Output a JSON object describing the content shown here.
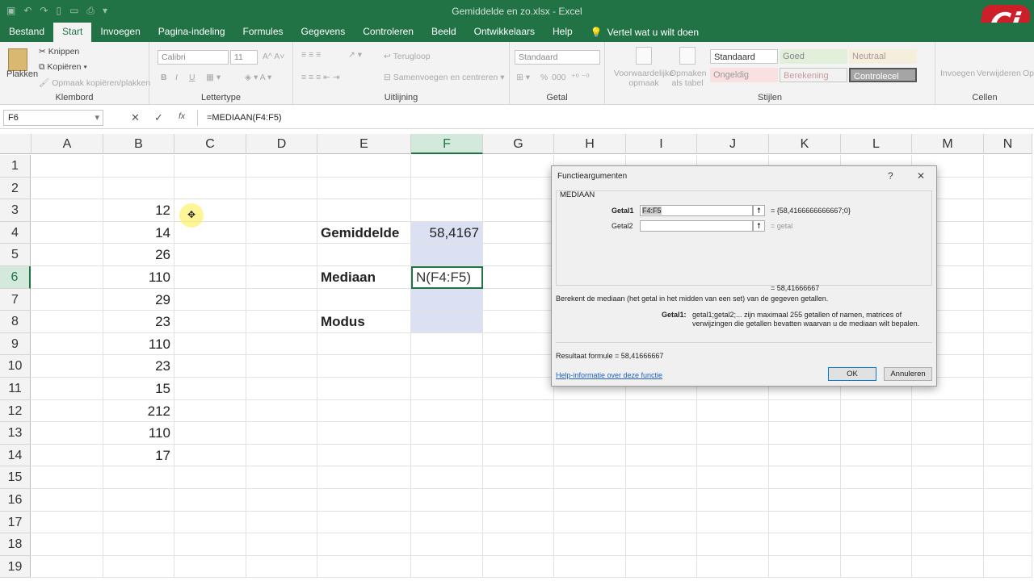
{
  "app": {
    "window_title": "Gemiddelde en zo.xlsx  -  Excel",
    "logo_text": "Ci"
  },
  "tabs": [
    "Bestand",
    "Start",
    "Invoegen",
    "Pagina-indeling",
    "Formules",
    "Gegevens",
    "Controleren",
    "Beeld",
    "Ontwikkelaars",
    "Help"
  ],
  "tell_me": "Vertel wat u wilt doen",
  "ribbon": {
    "clipboard": {
      "paste": "Plakken",
      "cut": "Knippen",
      "copy": "Kopiëren",
      "format_painter": "Opmaak kopiëren/plakken",
      "label": "Klembord"
    },
    "font": {
      "name": "Calibri",
      "size": "11",
      "label": "Lettertype",
      "bold": "B",
      "italic": "I",
      "underline": "U"
    },
    "alignment": {
      "wrap": "Terugloop",
      "merge": "Samenvoegen en centreren",
      "label": "Uitlijning"
    },
    "number": {
      "format": "Standaard",
      "percent": "%",
      "thousands": "000",
      "label": "Getal"
    },
    "styles": {
      "conditional": "Voorwaardelijke opmaak",
      "table": "Opmaken als tabel",
      "standaard": "Standaard",
      "goed": "Goed",
      "neutraal": "Neutraal",
      "ongeldig": "Ongeldig",
      "berekening": "Berekening",
      "controlecel": "Controlecel",
      "label": "Stijlen"
    },
    "cells": {
      "insert": "Invoegen",
      "delete": "Verwijderen",
      "format": "Opm",
      "label": "Cellen"
    }
  },
  "formula_bar": {
    "name_box": "F6",
    "fx": "fx",
    "formula": "=MEDIAAN(F4:F5)"
  },
  "columns": [
    "A",
    "B",
    "C",
    "D",
    "E",
    "F",
    "G",
    "H",
    "I",
    "J",
    "K",
    "L",
    "M",
    "N"
  ],
  "rows": [
    "1",
    "2",
    "3",
    "4",
    "5",
    "6",
    "7",
    "8",
    "9",
    "10",
    "11",
    "12",
    "13",
    "14",
    "15",
    "16",
    "17",
    "18",
    "19"
  ],
  "cells": {
    "B3": "12",
    "B4": "14",
    "B5": "26",
    "B6": "110",
    "B7": "29",
    "B8": "23",
    "B9": "110",
    "B10": "23",
    "B11": "15",
    "B12": "212",
    "B13": "110",
    "B14": "17",
    "E4": "Gemiddelde",
    "F4": "58,4167",
    "E6": "Mediaan",
    "F6": "N(F4:F5)",
    "E8": "Modus"
  },
  "dialog": {
    "title": "Functieargumenten",
    "help": "?",
    "close": "✕",
    "function": "MEDIAAN",
    "arg1_label": "Getal1",
    "arg1_value": "F4:F5",
    "arg1_result": "=  {58,4166666666667;0}",
    "arg2_label": "Getal2",
    "arg2_value": "",
    "arg2_result": "=  getal",
    "result_line": "=  58,41666667",
    "description": "Berekent de mediaan (het getal in het midden van een set) van de gegeven getallen.",
    "arg_help_label": "Getal1:",
    "arg_help_line1": "getal1;getal2;... zijn maximaal 255 getallen of namen, matrices of",
    "arg_help_line2": "verwijzingen die getallen bevatten waarvan u de mediaan wilt bepalen.",
    "result_formula": "Resultaat formule =    58,41666667",
    "help_link": "Help-informatie over deze functie",
    "ok": "OK",
    "cancel": "Annuleren"
  }
}
